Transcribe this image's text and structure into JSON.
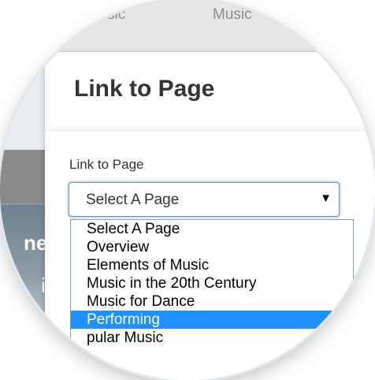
{
  "background": {
    "tabs": [
      "r Music",
      "Music"
    ],
    "words": [
      "nei",
      "i"
    ]
  },
  "modal": {
    "title": "Link to Page",
    "field_label": "Link to Page",
    "select": {
      "value": "Select A Page",
      "caret": "▼"
    },
    "options": [
      "Select A Page",
      "Overview",
      "Elements of Music",
      "Music in the 20th Century",
      "Music for Dance",
      "Performing",
      "pular Music"
    ],
    "highlighted_option": "Performing"
  },
  "colors": {
    "highlight": "#1e90ff",
    "select_border": "#6b8fb0"
  }
}
